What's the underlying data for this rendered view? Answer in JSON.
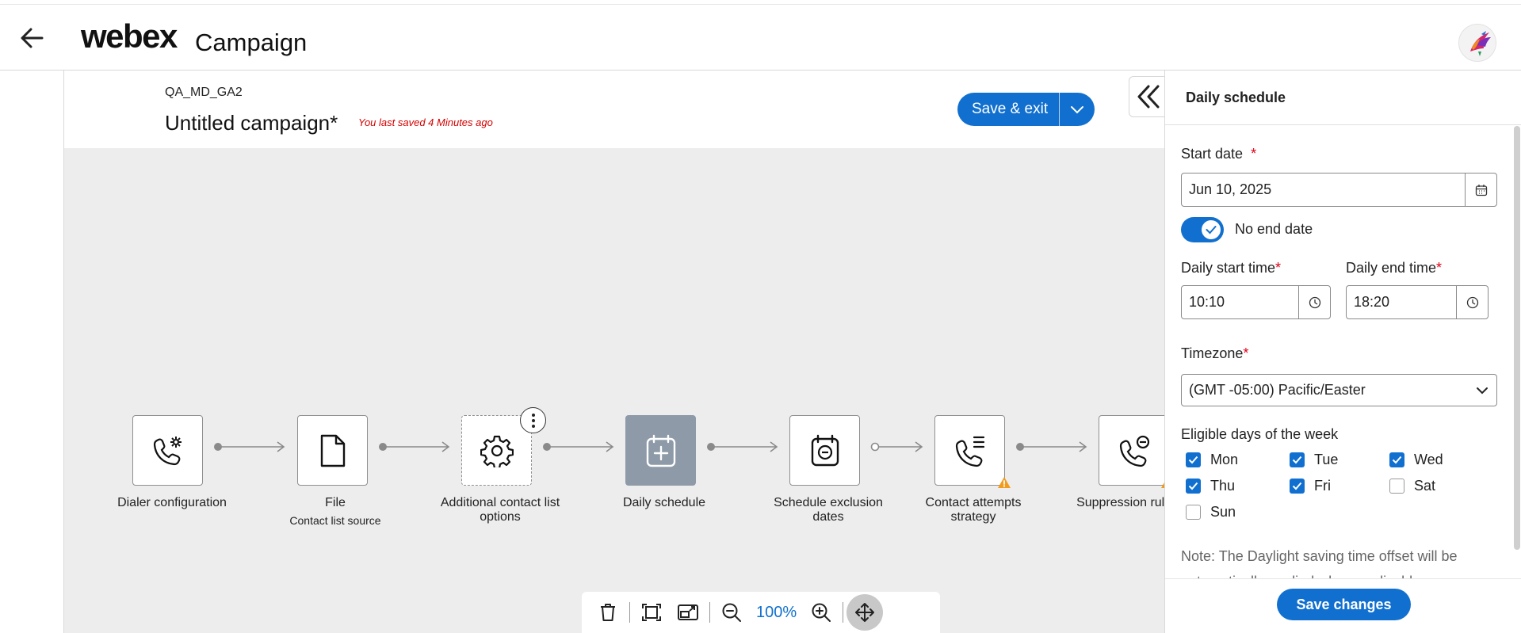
{
  "header": {
    "brand": "webex",
    "product": "Campaign"
  },
  "campaign": {
    "org_name": "QA_MD_GA2",
    "title": "Untitled campaign*",
    "saved_note": "You last saved 4 Minutes ago",
    "save_exit_label": "Save & exit"
  },
  "flow": {
    "nodes": [
      {
        "label": "Dialer configuration",
        "icon": "phone-gear-icon"
      },
      {
        "label": "File",
        "sub": "Contact list source",
        "icon": "file-icon"
      },
      {
        "label": "Additional contact list options",
        "icon": "gear-icon"
      },
      {
        "label": "Daily schedule",
        "icon": "calendar-add-icon"
      },
      {
        "label": "Schedule exclusion dates",
        "icon": "calendar-minus-icon"
      },
      {
        "label": "Contact attempts strategy",
        "icon": "phone-list-icon",
        "warning": true
      },
      {
        "label": "Suppression rule sets",
        "icon": "phone-minus-icon",
        "warning": true
      }
    ]
  },
  "toolbar": {
    "zoom": "100%"
  },
  "panel": {
    "title": "Daily schedule",
    "start_date_label": "Start date",
    "start_date": "Jun 10, 2025",
    "no_end_date_label": "No end date",
    "no_end_date_on": true,
    "daily_start_label": "Daily start time",
    "daily_start": "10:10",
    "daily_end_label": "Daily end time",
    "daily_end": "18:20",
    "timezone_label": "Timezone",
    "timezone": "(GMT -05:00) Pacific/Easter",
    "days_label": "Eligible days of the week",
    "days": [
      {
        "name": "Mon",
        "checked": true
      },
      {
        "name": "Tue",
        "checked": true
      },
      {
        "name": "Wed",
        "checked": true
      },
      {
        "name": "Thu",
        "checked": true
      },
      {
        "name": "Fri",
        "checked": true
      },
      {
        "name": "Sat",
        "checked": false
      },
      {
        "name": "Sun",
        "checked": false
      }
    ],
    "note": "Note: The Daylight saving time offset will be automatically applied when applicable.",
    "save_changes_label": "Save changes"
  },
  "colors": {
    "accent": "#1170cf",
    "required": "#e0001a",
    "saved_note": "#d40000",
    "canvas": "#ededed",
    "active_node": "#8e9aa8",
    "warning": "#f29c1f"
  }
}
